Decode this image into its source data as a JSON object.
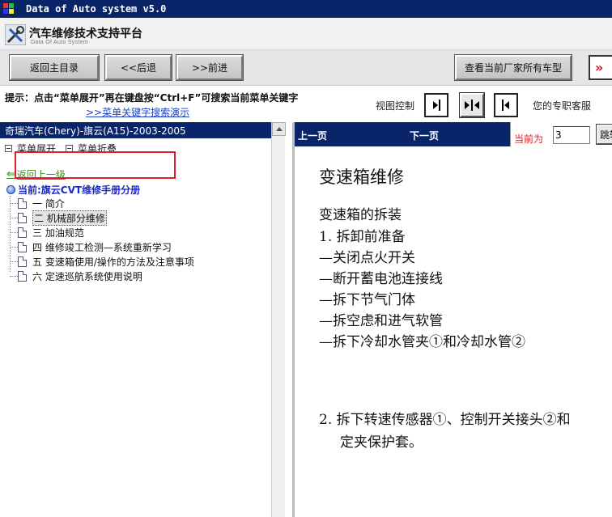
{
  "window": {
    "title": "Data of Auto system v5.0"
  },
  "header": {
    "title": "汽车维修技术支持平台",
    "subtitle": "Data Of Auto System"
  },
  "toolbar": {
    "home_label": "返回主目录",
    "back_label": "<<后退",
    "forward_label": ">>前进",
    "all_models_label": "查看当前厂家所有车型",
    "more_label": "»"
  },
  "hint": {
    "text": "提示：点击“菜单展开”再在键盘按“Ctrl+F”可搜索当前菜单关键字",
    "link": ">>菜单关键字搜索演示",
    "view_control_label": "视图控制",
    "support_label": "您的专职客服"
  },
  "left": {
    "vehicle_title": "奇瑞汽车(Chery)-旗云(A15)-2003-2005",
    "expand_label": "菜单展开",
    "collapse_label": "菜单折叠",
    "back_label": "返回上一级",
    "current_label": "当前:旗云CVT维修手册分册",
    "items": [
      {
        "label": "一 简介"
      },
      {
        "label": "二 机械部分维修"
      },
      {
        "label": "三 加油规范"
      },
      {
        "label": "四 维修竣工检测—系统重新学习"
      },
      {
        "label": "五 变速箱使用/操作的方法及注意事项"
      },
      {
        "label": "六 定速巡航系统使用说明"
      }
    ]
  },
  "right": {
    "prev_label": "上一页",
    "next_label": "下一页",
    "current_page_label": "当前为",
    "page_value": "3",
    "jump_label": "跳转"
  },
  "document": {
    "title": "变速箱维修",
    "section": "变速箱的拆装",
    "lines": [
      "1. 拆卸前准备",
      "—关闭点火开关",
      "—断开蓄电池连接线",
      "—拆下节气门体",
      "—拆空虑和进气软管",
      "—拆下冷却水管夹①和冷却水管②"
    ],
    "step2_line1": "2. 拆下转速传感器①、控制开关接头②和",
    "step2_line2": "定夹保护套。"
  },
  "colors": {
    "titlebar": "#0a246a",
    "link_blue": "#1a44c8",
    "highlight_red": "#e0202a",
    "back_green": "#3a8a1a"
  }
}
